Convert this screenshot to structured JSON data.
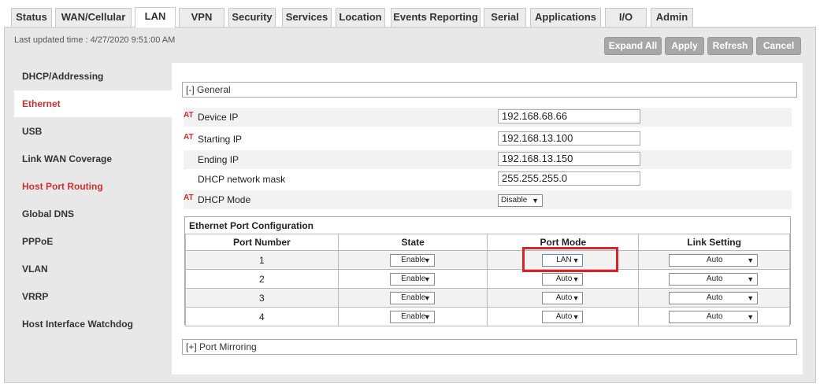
{
  "tabs": [
    "Status",
    "WAN/Cellular",
    "LAN",
    "VPN",
    "Security",
    "Services",
    "Location",
    "Events Reporting",
    "Serial",
    "Applications",
    "I/O",
    "Admin"
  ],
  "active_tab": "LAN",
  "last_updated": "Last updated time : 4/27/2020 9:51:00 AM",
  "buttons": {
    "expand_all": "Expand All",
    "apply": "Apply",
    "refresh": "Refresh",
    "cancel": "Cancel"
  },
  "sidebar": {
    "items": [
      {
        "label": "DHCP/Addressing",
        "color": "#333333"
      },
      {
        "label": "Ethernet",
        "color": "#d12f2f",
        "selected": true
      },
      {
        "label": "USB",
        "color": "#333333"
      },
      {
        "label": "Link WAN Coverage",
        "color": "#333333"
      },
      {
        "label": "Host Port Routing",
        "color": "#d12f2f"
      },
      {
        "label": "Global DNS",
        "color": "#333333"
      },
      {
        "label": "PPPoE",
        "color": "#333333"
      },
      {
        "label": "VLAN",
        "color": "#333333"
      },
      {
        "label": "VRRP",
        "color": "#333333"
      },
      {
        "label": "Host Interface Watchdog",
        "color": "#333333"
      }
    ]
  },
  "general": {
    "header": "[-] General",
    "at_marker": "AT",
    "fields": [
      {
        "label": "Device IP",
        "value": "192.168.68.66",
        "at": true
      },
      {
        "label": "Starting IP",
        "value": "192.168.13.100",
        "at": true
      },
      {
        "label": "Ending IP",
        "value": "192.168.13.150",
        "at": false
      },
      {
        "label": "DHCP network mask",
        "value": "255.255.255.0",
        "at": false
      }
    ],
    "dhcp_mode": {
      "label": "DHCP Mode",
      "value": "Disable",
      "at": true
    }
  },
  "port_config": {
    "title": "Ethernet Port Configuration",
    "columns": [
      "Port Number",
      "State",
      "Port Mode",
      "Link Setting"
    ],
    "rows": [
      {
        "port": "1",
        "state": "Enable",
        "mode": "LAN",
        "link": "Auto"
      },
      {
        "port": "2",
        "state": "Enable",
        "mode": "Auto",
        "link": "Auto"
      },
      {
        "port": "3",
        "state": "Enable",
        "mode": "Auto",
        "link": "Auto"
      },
      {
        "port": "4",
        "state": "Enable",
        "mode": "Auto",
        "link": "Auto"
      }
    ]
  },
  "port_mirroring": {
    "header": "[+] Port Mirroring"
  },
  "colors": {
    "accent_red": "#d12f2f",
    "highlight_box": "#d8232a",
    "button_gray": "#a7a7a7"
  }
}
